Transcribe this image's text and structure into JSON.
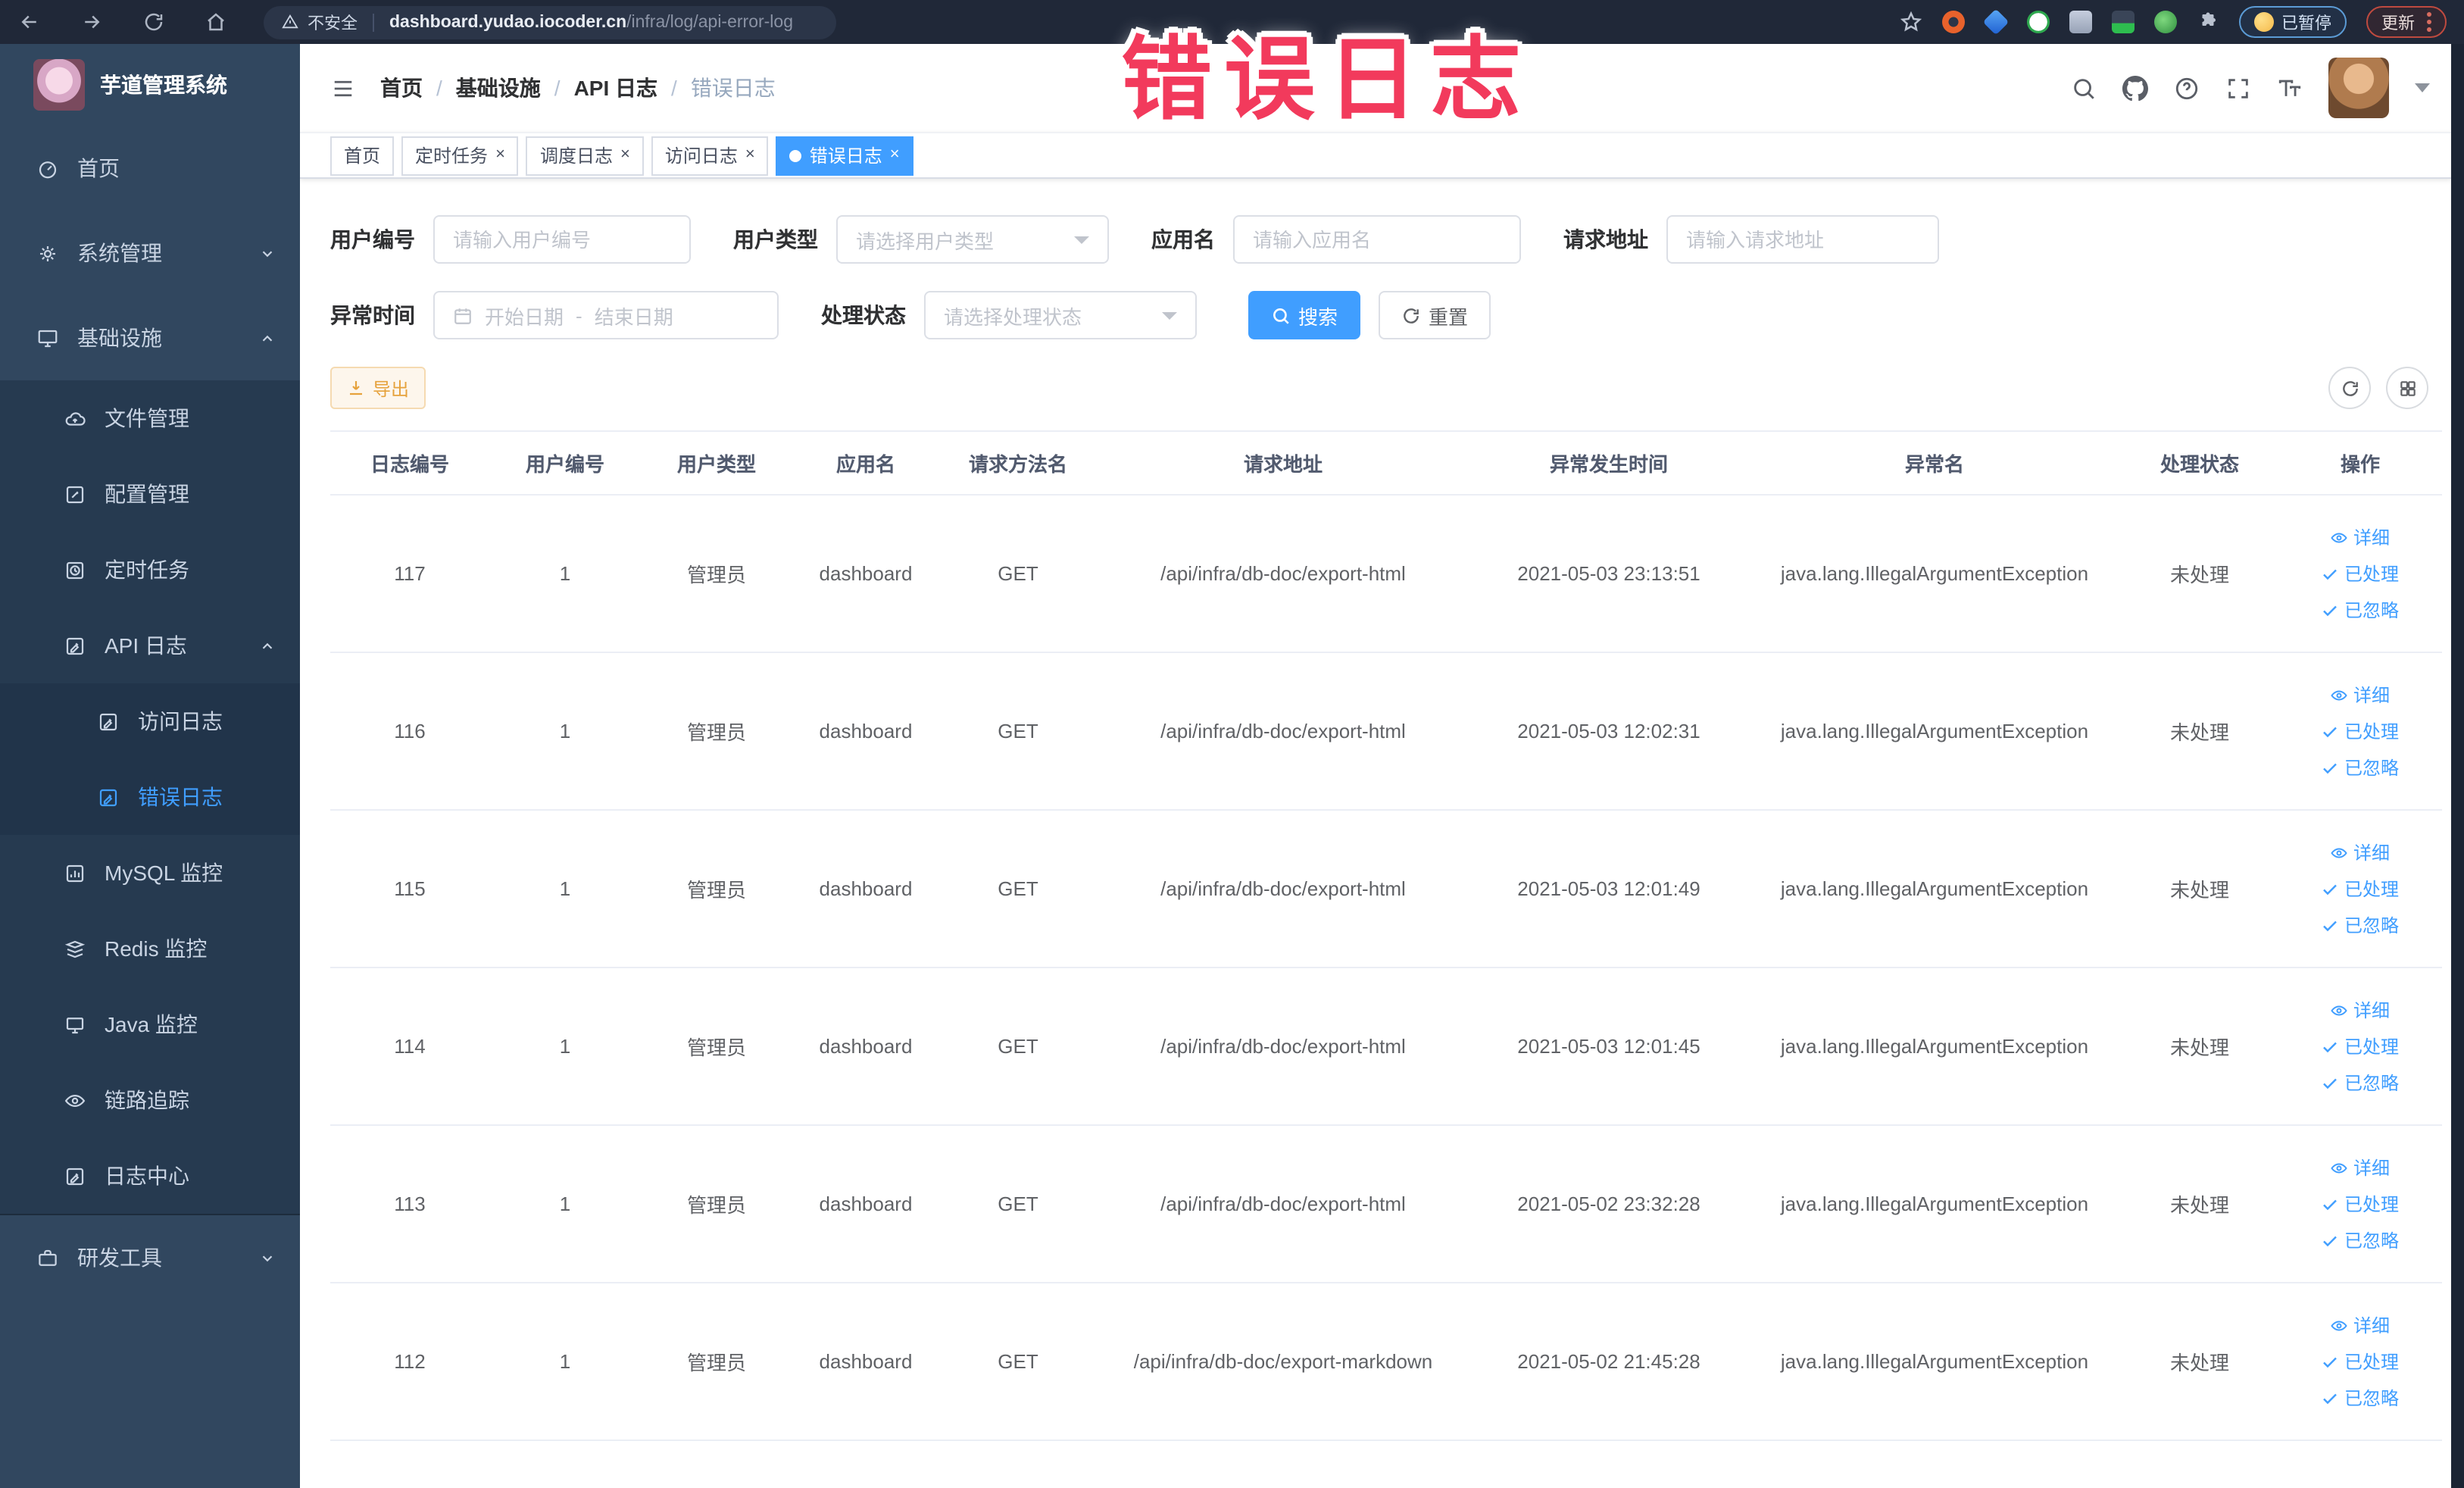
{
  "browser": {
    "security_label": "不安全",
    "url_domain": "dashboard.yudao.iocoder.cn",
    "url_path": "/infra/log/api-error-log",
    "paused_label": "已暂停",
    "update_label": "更新"
  },
  "annotation": {
    "text": "错误日志"
  },
  "sidebar": {
    "app_title": "芋道管理系统",
    "items": [
      {
        "label": "首页"
      },
      {
        "label": "系统管理"
      },
      {
        "label": "基础设施"
      },
      {
        "label": "文件管理"
      },
      {
        "label": "配置管理"
      },
      {
        "label": "定时任务"
      },
      {
        "label": "API 日志"
      },
      {
        "label": "访问日志"
      },
      {
        "label": "错误日志"
      },
      {
        "label": "MySQL 监控"
      },
      {
        "label": "Redis 监控"
      },
      {
        "label": "Java 监控"
      },
      {
        "label": "链路追踪"
      },
      {
        "label": "日志中心"
      },
      {
        "label": "研发工具"
      }
    ]
  },
  "header": {
    "breadcrumb": [
      "首页",
      "基础设施",
      "API 日志",
      "错误日志"
    ]
  },
  "tabs": [
    {
      "label": "首页"
    },
    {
      "label": "定时任务"
    },
    {
      "label": "调度日志"
    },
    {
      "label": "访问日志"
    },
    {
      "label": "错误日志"
    }
  ],
  "filters": {
    "user_id": {
      "label": "用户编号",
      "placeholder": "请输入用户编号"
    },
    "user_type": {
      "label": "用户类型",
      "placeholder": "请选择用户类型"
    },
    "app_name": {
      "label": "应用名",
      "placeholder": "请输入应用名"
    },
    "request_url": {
      "label": "请求地址",
      "placeholder": "请输入请求地址"
    },
    "exception_time": {
      "label": "异常时间",
      "start_placeholder": "开始日期",
      "separator": "-",
      "end_placeholder": "结束日期"
    },
    "process_status": {
      "label": "处理状态",
      "placeholder": "请选择处理状态"
    },
    "search_label": "搜索",
    "reset_label": "重置"
  },
  "toolbar": {
    "export_label": "导出"
  },
  "table": {
    "columns": [
      "日志编号",
      "用户编号",
      "用户类型",
      "应用名",
      "请求方法名",
      "请求地址",
      "异常发生时间",
      "异常名",
      "处理状态",
      "操作"
    ],
    "actions": {
      "detail": "详细",
      "processed": "已处理",
      "ignored": "已忽略"
    },
    "rows": [
      {
        "id": "117",
        "user_id": "1",
        "user_type": "管理员",
        "app_name": "dashboard",
        "method": "GET",
        "url": "/api/infra/db-doc/export-html",
        "time": "2021-05-03 23:13:51",
        "exception": "java.lang.IllegalArgumentException",
        "status": "未处理"
      },
      {
        "id": "116",
        "user_id": "1",
        "user_type": "管理员",
        "app_name": "dashboard",
        "method": "GET",
        "url": "/api/infra/db-doc/export-html",
        "time": "2021-05-03 12:02:31",
        "exception": "java.lang.IllegalArgumentException",
        "status": "未处理"
      },
      {
        "id": "115",
        "user_id": "1",
        "user_type": "管理员",
        "app_name": "dashboard",
        "method": "GET",
        "url": "/api/infra/db-doc/export-html",
        "time": "2021-05-03 12:01:49",
        "exception": "java.lang.IllegalArgumentException",
        "status": "未处理"
      },
      {
        "id": "114",
        "user_id": "1",
        "user_type": "管理员",
        "app_name": "dashboard",
        "method": "GET",
        "url": "/api/infra/db-doc/export-html",
        "time": "2021-05-03 12:01:45",
        "exception": "java.lang.IllegalArgumentException",
        "status": "未处理"
      },
      {
        "id": "113",
        "user_id": "1",
        "user_type": "管理员",
        "app_name": "dashboard",
        "method": "GET",
        "url": "/api/infra/db-doc/export-html",
        "time": "2021-05-02 23:32:28",
        "exception": "java.lang.IllegalArgumentException",
        "status": "未处理"
      },
      {
        "id": "112",
        "user_id": "1",
        "user_type": "管理员",
        "app_name": "dashboard",
        "method": "GET",
        "url": "/api/infra/db-doc/export-markdown",
        "time": "2021-05-02 21:45:28",
        "exception": "java.lang.IllegalArgumentException",
        "status": "未处理"
      }
    ]
  },
  "colors": {
    "accent": "#409eff",
    "warning": "#e6a23c",
    "annotation": "#f23a5c",
    "sidebar_bg": "#31475f",
    "chrome_bg": "#202838"
  }
}
